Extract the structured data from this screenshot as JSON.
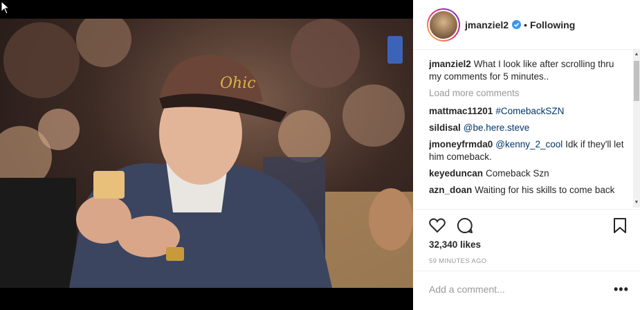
{
  "post": {
    "username": "jmanziel2",
    "follow_separator": "•",
    "follow_status": "Following",
    "cap_text": "Ohic"
  },
  "caption": {
    "username": "jmanziel2",
    "text": "What I look like after scrolling thru my comments for 5 minutes.."
  },
  "load_more": "Load more comments",
  "comments": [
    {
      "username": "mattmac11201",
      "tag": "#ComebackSZN",
      "text": ""
    },
    {
      "username": "sildisal",
      "tag": "@be.here.steve",
      "text": ""
    },
    {
      "username": "jmoneyfrmda0",
      "tag": "@kenny_2_cool",
      "text": "Idk if they'll let him comeback."
    },
    {
      "username": "keyeduncan",
      "tag": "",
      "text": "Comeback Szn"
    },
    {
      "username": "azn_doan",
      "tag": "",
      "text": "Waiting for his skills to come back"
    }
  ],
  "likes": "32,340 likes",
  "timestamp": "59 MINUTES AGO",
  "add_comment_placeholder": "Add a comment...",
  "more_options": "•••",
  "icons": {
    "like": "heart-icon",
    "comment": "comment-icon",
    "save": "bookmark-icon",
    "verified": "verified-badge-icon"
  },
  "colors": {
    "link": "#003569",
    "verified": "#3897f0",
    "muted": "#999999"
  }
}
